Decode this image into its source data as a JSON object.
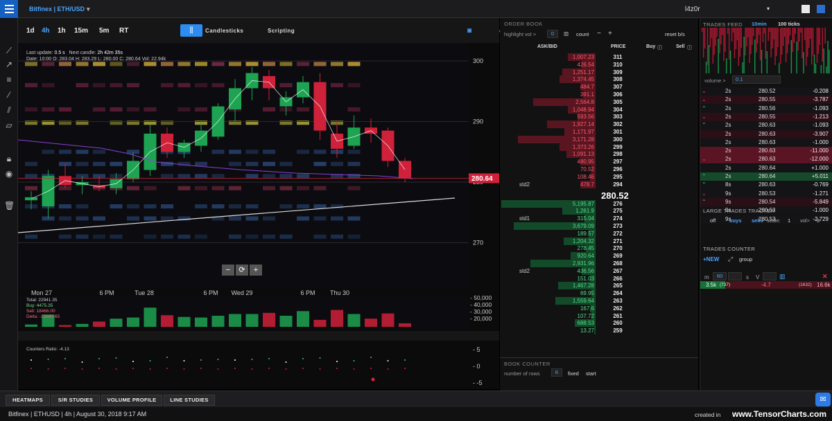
{
  "header": {
    "symbol": "Bitfinex | ETH/USD",
    "symbol_caret": "▾",
    "user": "l4z0r",
    "user_caret": "▾"
  },
  "toolbar": {
    "timeframes": [
      "1d",
      "4h",
      "1h",
      "15m",
      "5m",
      "RT"
    ],
    "active_timeframe": "4h",
    "chart_type_icon": "bars-icon",
    "candlesticks": "Candlesticks",
    "scripting": "Scripting"
  },
  "chart_info": {
    "line1_a": "Last update:",
    "line1_b": "0.5 s",
    "line1_c": "Next candle:",
    "line1_d": "2h 42m 35s",
    "line2": "Date: 10:00  O: 283.04  H: 283.29  L: 280.00  C: 280.64  Vol: 22.94k"
  },
  "chart_data": {
    "type": "candlestick",
    "price_axis": {
      "ticks": [
        300,
        290,
        280,
        270
      ],
      "range": [
        265,
        305
      ]
    },
    "current_price_label": "280.64",
    "x_labels": [
      "Mon 27",
      "6 PM",
      "Tue 28",
      "6 PM",
      "Wed 29",
      "6 PM",
      "Thu 30"
    ],
    "candles": [
      {
        "o": 277.0,
        "h": 278.5,
        "l": 275.5,
        "c": 277.5
      },
      {
        "o": 276.0,
        "h": 282.0,
        "l": 274.0,
        "c": 281.0
      },
      {
        "o": 281.0,
        "h": 283.0,
        "l": 279.0,
        "c": 279.5
      },
      {
        "o": 279.5,
        "h": 281.0,
        "l": 278.0,
        "c": 280.0
      },
      {
        "o": 279.5,
        "h": 281.0,
        "l": 278.5,
        "c": 279.0
      },
      {
        "o": 279.0,
        "h": 281.5,
        "l": 278.0,
        "c": 280.5
      },
      {
        "o": 280.5,
        "h": 285.0,
        "l": 280.0,
        "c": 283.5
      },
      {
        "o": 282.0,
        "h": 289.5,
        "l": 281.0,
        "c": 288.0
      },
      {
        "o": 288.0,
        "h": 289.0,
        "l": 284.0,
        "c": 285.0
      },
      {
        "o": 285.0,
        "h": 287.0,
        "l": 284.0,
        "c": 286.5
      },
      {
        "o": 286.0,
        "h": 290.0,
        "l": 285.0,
        "c": 288.5
      },
      {
        "o": 287.5,
        "h": 293.0,
        "l": 287.0,
        "c": 292.5
      },
      {
        "o": 292.0,
        "h": 297.0,
        "l": 290.0,
        "c": 295.5
      },
      {
        "o": 295.5,
        "h": 299.0,
        "l": 293.5,
        "c": 298.0
      },
      {
        "o": 297.5,
        "h": 298.5,
        "l": 293.5,
        "c": 295.5
      },
      {
        "o": 292.5,
        "h": 295.0,
        "l": 291.0,
        "c": 294.0
      },
      {
        "o": 294.0,
        "h": 297.5,
        "l": 293.0,
        "c": 296.5
      },
      {
        "o": 296.5,
        "h": 298.0,
        "l": 287.0,
        "c": 288.5
      },
      {
        "o": 288.0,
        "h": 290.0,
        "l": 284.0,
        "c": 285.5
      },
      {
        "o": 286.0,
        "h": 291.0,
        "l": 285.5,
        "c": 289.0
      },
      {
        "o": 289.0,
        "h": 290.5,
        "l": 286.5,
        "c": 288.0
      },
      {
        "o": 288.5,
        "h": 289.0,
        "l": 282.5,
        "c": 283.5
      },
      {
        "o": 283.5,
        "h": 284.0,
        "l": 280.0,
        "c": 280.6
      }
    ],
    "volume_axis": [
      "40,000",
      "30,000",
      "20,000"
    ],
    "volume_axis_top": "50,000",
    "volumes": [
      4,
      21,
      3,
      5,
      9,
      14,
      16,
      33,
      20,
      17,
      16,
      19,
      22,
      22,
      24,
      19,
      27,
      12,
      29,
      22,
      14,
      23,
      6
    ],
    "ratio_axis": [
      "5",
      "0",
      "-5"
    ]
  },
  "volume_info": {
    "total": "Total: 22941.35",
    "buy": "Buy: 4475.35",
    "sell": "Sell: 18466.00",
    "delta": "Delta: -13990.65"
  },
  "ratio_label": "Counters Ratio: -4.13",
  "order_book": {
    "title": "ORDER BOOK",
    "highlight_label": "highlight vol >",
    "highlight_value": "0",
    "count_label": "count",
    "reset_label": "reset b/s",
    "col_askbid": "ASK/BID",
    "col_price": "PRICE",
    "col_buy": "Buy",
    "col_sell": "Sell",
    "last_price": "280.52",
    "asks": [
      {
        "v": "1,007.23",
        "p": "311",
        "w": 40
      },
      {
        "v": "426.54",
        "p": "310",
        "w": 20
      },
      {
        "v": "1,251.17",
        "p": "309",
        "w": 48
      },
      {
        "v": "1,374.45",
        "p": "308",
        "w": 52
      },
      {
        "v": "484.7",
        "p": "307",
        "w": 22
      },
      {
        "v": "391.1",
        "p": "306",
        "w": 18
      },
      {
        "v": "2,564.8",
        "p": "305",
        "w": 90
      },
      {
        "v": "1,048.94",
        "p": "304",
        "w": 40
      },
      {
        "v": "593.56",
        "p": "303",
        "w": 26
      },
      {
        "v": "1,927.14",
        "p": "302",
        "w": 70
      },
      {
        "v": "1,171.97",
        "p": "301",
        "w": 45
      },
      {
        "v": "3,171.28",
        "p": "300",
        "w": 112
      },
      {
        "v": "1,373.26",
        "p": "299",
        "w": 52
      },
      {
        "v": "1,091.13",
        "p": "298",
        "w": 42
      },
      {
        "v": "480.95",
        "p": "297",
        "w": 22
      },
      {
        "v": "70.52",
        "p": "296",
        "w": 6
      },
      {
        "v": "108.46",
        "p": "295",
        "w": 8
      },
      {
        "v": "478.7",
        "p": "294",
        "w": 22,
        "std": "std2"
      }
    ],
    "bids": [
      {
        "v": "5,195.87",
        "p": "276",
        "w": 136
      },
      {
        "v": "1,261.9",
        "p": "275",
        "w": 48
      },
      {
        "v": "315.04",
        "p": "274",
        "w": 16,
        "std": "std1"
      },
      {
        "v": "3,679.09",
        "p": "273",
        "w": 118
      },
      {
        "v": "189.57",
        "p": "272",
        "w": 10
      },
      {
        "v": "1,204.32",
        "p": "271",
        "w": 46
      },
      {
        "v": "278.45",
        "p": "270",
        "w": 14
      },
      {
        "v": "920.64",
        "p": "269",
        "w": 36
      },
      {
        "v": "2,931.96",
        "p": "268",
        "w": 94
      },
      {
        "v": "436.56",
        "p": "267",
        "w": 20,
        "std": "std2"
      },
      {
        "v": "151.03",
        "p": "266",
        "w": 8
      },
      {
        "v": "1,467.28",
        "p": "265",
        "w": 54
      },
      {
        "v": "69.95",
        "p": "264",
        "w": 6
      },
      {
        "v": "1,559.64",
        "p": "263",
        "w": 58
      },
      {
        "v": "167.6",
        "p": "262",
        "w": 8
      },
      {
        "v": "107.72",
        "p": "261",
        "w": 6
      },
      {
        "v": "688.53",
        "p": "260",
        "w": 30
      },
      {
        "v": "13.27",
        "p": "259",
        "w": 2
      }
    ]
  },
  "book_counter": {
    "title": "BOOK COUNTER",
    "rows_label": "number of rows",
    "rows_value": "6",
    "fixed": "fixed",
    "start": "start"
  },
  "trades_feed": {
    "title": "TRADES FEED",
    "interval": "10min",
    "ticks": "100 ticks",
    "volume_label": "volume >",
    "volume_value": "0.1",
    "rows": [
      {
        "dir": "down",
        "t": "2s",
        "p": "280.52",
        "v": "-0.208",
        "kind": "sell0"
      },
      {
        "dir": "down",
        "t": "2s",
        "p": "280.55",
        "v": "-3.787",
        "kind": "sell1"
      },
      {
        "dir": "up",
        "t": "2s",
        "p": "280.56",
        "v": "-1.093",
        "kind": "sell0"
      },
      {
        "dir": "down",
        "t": "2s",
        "p": "280.55",
        "v": "-1.213",
        "kind": "sell1"
      },
      {
        "dir": "up",
        "t": "2s",
        "p": "280.63",
        "v": "-1.093",
        "kind": "sell0"
      },
      {
        "dir": "",
        "t": "2s",
        "p": "280.63",
        "v": "-3.907",
        "kind": "sell1"
      },
      {
        "dir": "",
        "t": "2s",
        "p": "280.63",
        "v": "-1.000",
        "kind": "sell0"
      },
      {
        "dir": "",
        "t": "2s",
        "p": "280.63",
        "v": "-11.000",
        "kind": "sell2"
      },
      {
        "dir": "down",
        "t": "2s",
        "p": "280.63",
        "v": "-12.000",
        "kind": "sell2"
      },
      {
        "dir": "",
        "t": "2s",
        "p": "280.64",
        "v": "+1.000",
        "kind": "buy0"
      },
      {
        "dir": "up",
        "t": "2s",
        "p": "280.64",
        "v": "+5.011",
        "kind": "buy1"
      },
      {
        "dir": "up",
        "t": "8s",
        "p": "280.63",
        "v": "-0.769",
        "kind": "sell0"
      },
      {
        "dir": "down",
        "t": "9s",
        "p": "280.53",
        "v": "-1.271",
        "kind": "sell0"
      },
      {
        "dir": "up",
        "t": "9s",
        "p": "280.54",
        "v": "-5.849",
        "kind": "sell1"
      },
      {
        "dir": "",
        "t": "9s",
        "p": "280.53",
        "v": "-1.000",
        "kind": "sell0"
      },
      {
        "dir": "",
        "t": "9s",
        "p": "280.53",
        "v": "-2.729",
        "kind": "sell0"
      }
    ]
  },
  "large_trades": {
    "title": "LARGE TRADES TRACKER",
    "off": "off",
    "buys": "buys",
    "sells": "sells",
    "scale_label": "scale:",
    "scale_value": "1",
    "vol_label": "vol>",
    "vol_value": "0"
  },
  "trades_counter": {
    "title": "TRADES COUNTER",
    "new_label": "NEW",
    "group_label": "group",
    "m_label": "m",
    "m_value": "60",
    "s_label": "s",
    "v_label": "V",
    "buy": "3.5k",
    "buy_count": "(737)",
    "delta": "-4.7",
    "sell_count": "(1632)",
    "sell": "16.6k"
  },
  "bottom_tabs": [
    "HEATMAPS",
    "S/R STUDIES",
    "VOLUME PROFILE",
    "LINE STUDIES"
  ],
  "status": {
    "text": "Bitfinex | ETHUSD | 4h | August 30, 2018 9:17 AM",
    "created_in": "created in",
    "site": "www.TensorCharts.com"
  },
  "colors": {
    "accent": "#2c8cf0",
    "up": "#1ea352",
    "down": "#d0213a",
    "ask_bar": "#5a1620",
    "bid_bar": "#134a2a"
  }
}
